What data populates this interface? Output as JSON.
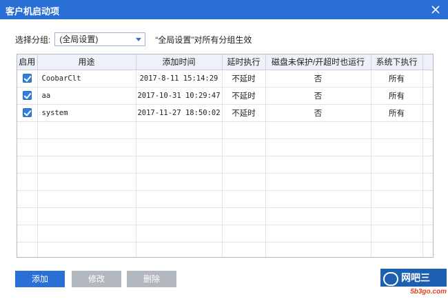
{
  "window": {
    "title": "客户机启动项",
    "close_icon": "close-icon"
  },
  "group_selector": {
    "label": "选择分组:",
    "value": "(全局设置)",
    "note": "“全局设置”对所有分组生效"
  },
  "table": {
    "columns": [
      "启用",
      "用途",
      "添加时间",
      "延时执行",
      "磁盘未保护/开超时也运行",
      "系统下执行"
    ],
    "rows": [
      {
        "enabled": true,
        "purpose": "CoobarClt",
        "added": "2017-8-11 15:14:29",
        "delay": "不延时",
        "run_unprotected": "否",
        "system": "所有"
      },
      {
        "enabled": true,
        "purpose": "aa",
        "added": "2017-10-31 10:29:47",
        "delay": "不延时",
        "run_unprotected": "否",
        "system": "所有"
      },
      {
        "enabled": true,
        "purpose": "system",
        "added": "2017-11-27 18:50:02",
        "delay": "不延时",
        "run_unprotected": "否",
        "system": "所有"
      }
    ]
  },
  "buttons": {
    "add": "添加",
    "edit": "修改",
    "delete": "删除"
  },
  "watermark": {
    "brand": "网吧三",
    "site": "5b3go.com"
  },
  "colors": {
    "accent": "#2a6fd6",
    "disabled": "#b3b8bf",
    "checkbox": "#2f7fdf"
  }
}
